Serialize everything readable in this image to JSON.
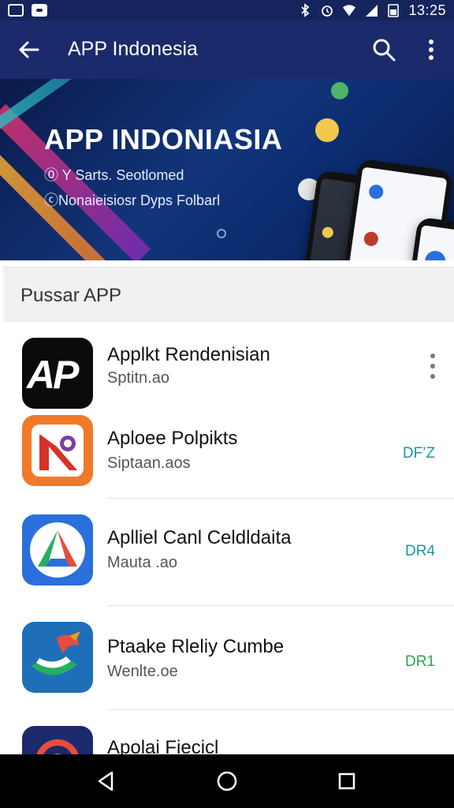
{
  "status_bar": {
    "time": "13:25",
    "icons": [
      "image-icon",
      "message-icon",
      "bluetooth-icon",
      "alarm-icon",
      "wifi-icon",
      "signal-icon",
      "battery-icon"
    ]
  },
  "app_bar": {
    "title": "APP Indonesia",
    "icons": [
      "back-arrow-icon",
      "search-icon",
      "more-vert-icon"
    ]
  },
  "banner": {
    "headline": "APP INDONIASIA",
    "line1": "⓪ Y Sarts. Seotlomed",
    "line2": "ⓒNonaieisiosr Dyps Folbarl"
  },
  "section": {
    "title": "Pussar APP"
  },
  "apps": [
    {
      "name": "Applkt Rendenisian",
      "subtitle": "Sptitn.ao",
      "tag": "",
      "icon": "ap-logo-icon",
      "icon_text": "AP"
    },
    {
      "name": "Aploee Polpikts",
      "subtitle": "Siptaan.aos",
      "tag": "DF’Z",
      "icon": "orange-k-icon"
    },
    {
      "name": "Aplliel Canl Celdldaita",
      "subtitle": "Mauta .ao",
      "tag": "DR4",
      "icon": "colorful-a-icon"
    },
    {
      "name": "Ptaake Rleliy Cumbe",
      "subtitle": "Wenlte.oe",
      "tag": "DR1",
      "icon": "bird-flag-icon"
    },
    {
      "name": "Apolai Fiecicl",
      "subtitle": "",
      "tag": "",
      "icon": "circle-app-icon"
    }
  ],
  "colors": {
    "status_bar": "#15245c",
    "app_bar": "#1b2a6b",
    "tag_teal": "#1a9aa0",
    "tag_green": "#2ea44f"
  },
  "nav_bar": {
    "buttons": [
      "nav-back-icon",
      "nav-home-icon",
      "nav-recents-icon"
    ]
  }
}
